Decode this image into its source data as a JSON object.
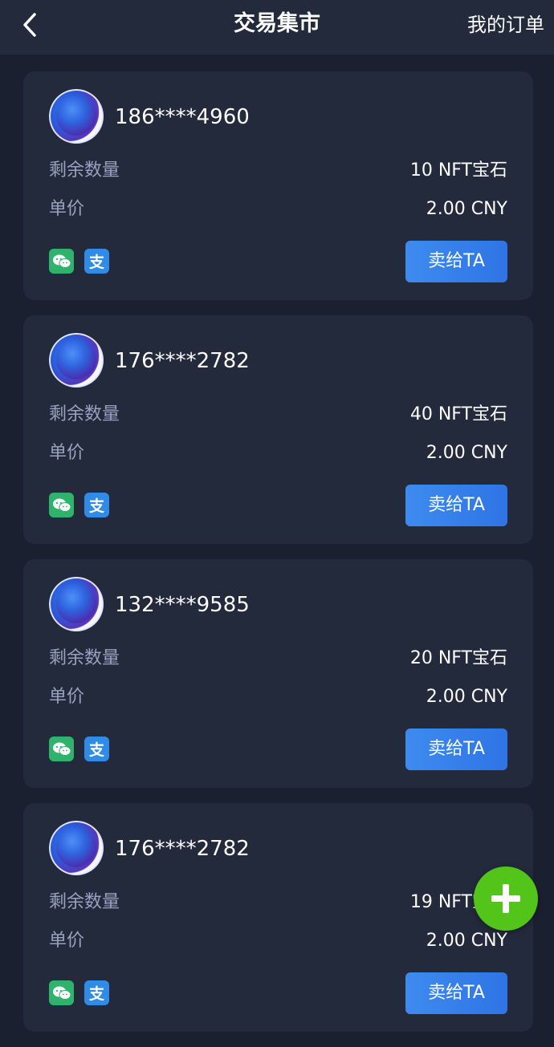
{
  "header": {
    "title": "交易集市",
    "orders_label": "我的订单"
  },
  "labels": {
    "remaining": "剩余数量",
    "unit_price": "单价",
    "sell_button": "卖给TA",
    "alipay_glyph": "支"
  },
  "listings": [
    {
      "phone": "186****4960",
      "remaining": "10 NFT宝石",
      "price": "2.00 CNY"
    },
    {
      "phone": "176****2782",
      "remaining": "40 NFT宝石",
      "price": "2.00 CNY"
    },
    {
      "phone": "132****9585",
      "remaining": "20 NFT宝石",
      "price": "2.00 CNY"
    },
    {
      "phone": "176****2782",
      "remaining": "19 NFT宝石",
      "price": "2.00 CNY"
    }
  ],
  "icons": {
    "back": "chevron-left-icon",
    "wechat": "wechat-icon",
    "alipay": "alipay-icon",
    "add": "plus-icon"
  },
  "colors": {
    "background": "#1b2030",
    "card": "#232a3c",
    "accent": "#3d8bf0",
    "fab": "#52c41a",
    "wechat": "#2fb36c",
    "alipay": "#2f8be6"
  }
}
